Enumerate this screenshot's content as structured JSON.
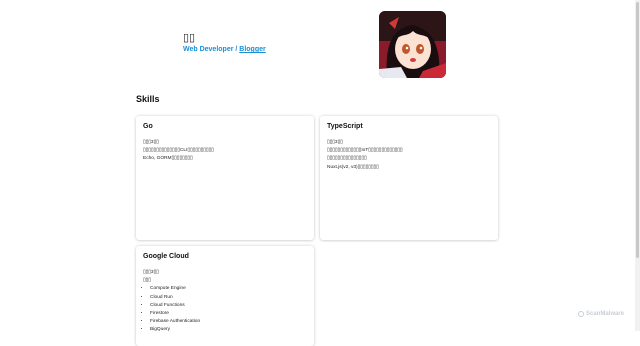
{
  "profile": {
    "name": "▯▯",
    "role_prefix": "Web Developer / ",
    "blog_link": "Blogger"
  },
  "skills": {
    "title": "Skills",
    "cards": [
      {
        "title": "Go",
        "lines": [
          "▯▯▯3▯▯",
          "▯▯▯▯▯▯▯▯▯▯▯▯▯▯CLI▯▯▯▯▯▯▯▯▯▯",
          "Echo, GORM▯▯▯▯▯▯▯▯"
        ]
      },
      {
        "title": "TypeScript",
        "lines": [
          "▯▯▯3▯▯",
          "▯▯▯▯▯▯▯▯▯▯▯▯▯IoT▯▯▯▯▯▯▯▯▯▯▯▯▯",
          "▯▯▯▯▯▯▯▯▯▯▯▯▯▯▯",
          "Nuxt.js(v2, v3)▯▯▯▯▯▯▯▯"
        ]
      },
      {
        "title": "Google Cloud",
        "lines": [
          "▯▯▯3▯▯",
          "▯▯▯"
        ],
        "items": [
          "Compute Engine",
          "Cloud Run",
          "Cloud Functions",
          "Firestore",
          "Firebase Authentication",
          "BigQuery"
        ]
      }
    ]
  },
  "watermark": {
    "text": "ScanMalware"
  },
  "colors": {
    "accent": "#1a8fd6",
    "background": "#ffffff"
  }
}
